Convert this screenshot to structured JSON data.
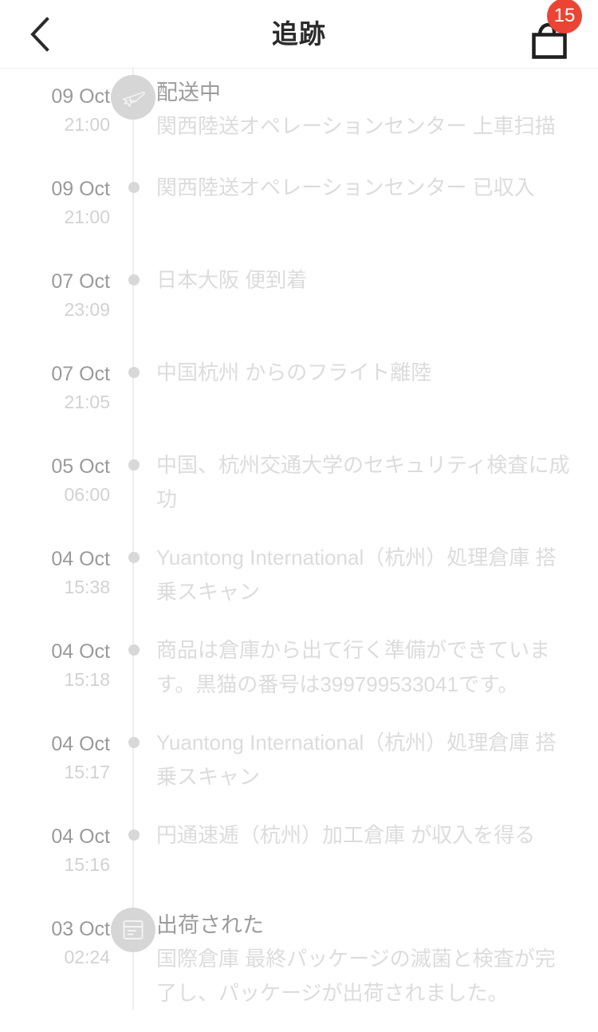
{
  "header": {
    "title": "追跡",
    "back_icon": "chevron-left-icon",
    "bag_icon": "shopping-bag-icon",
    "bag_badge_count": "15",
    "badge_color": "#ec4434"
  },
  "timeline": {
    "events": [
      {
        "date": "09 Oct",
        "time": "21:00",
        "marker": "airplane-icon",
        "title": "配送中",
        "desc": "関西陸送オペレーションセンター 上車扫描"
      },
      {
        "date": "09 Oct",
        "time": "21:00",
        "marker": "dot",
        "title": "",
        "desc": "関西陸送オペレーションセンター 已収入"
      },
      {
        "date": "07 Oct",
        "time": "23:09",
        "marker": "dot",
        "title": "",
        "desc": "日本大阪 便到着"
      },
      {
        "date": "07 Oct",
        "time": "21:05",
        "marker": "dot",
        "title": "",
        "desc": "中国杭州 からのフライト離陸"
      },
      {
        "date": "05 Oct",
        "time": "06:00",
        "marker": "dot",
        "title": "",
        "desc": "中国、杭州交通大学のセキュリティ検査に成功"
      },
      {
        "date": "04 Oct",
        "time": "15:38",
        "marker": "dot",
        "title": "",
        "desc": "Yuantong International（杭州）処理倉庫 搭乗スキャン"
      },
      {
        "date": "04 Oct",
        "time": "15:18",
        "marker": "dot",
        "title": "",
        "desc": "商品は倉庫から出て行く準備ができています。黒猫の番号は399799533041です。"
      },
      {
        "date": "04 Oct",
        "time": "15:17",
        "marker": "dot",
        "title": "",
        "desc": "Yuantong International（杭州）処理倉庫 搭乗スキャン"
      },
      {
        "date": "04 Oct",
        "time": "15:16",
        "marker": "dot",
        "title": "",
        "desc": "円通速逓（杭州）加工倉庫 が収入を得る"
      },
      {
        "date": "03 Oct",
        "time": "02:24",
        "marker": "package-box-icon",
        "title": "出荷された",
        "desc": "国際倉庫 最終パッケージの滅菌と検査が完了し、パッケージが出荷されました。"
      }
    ]
  }
}
